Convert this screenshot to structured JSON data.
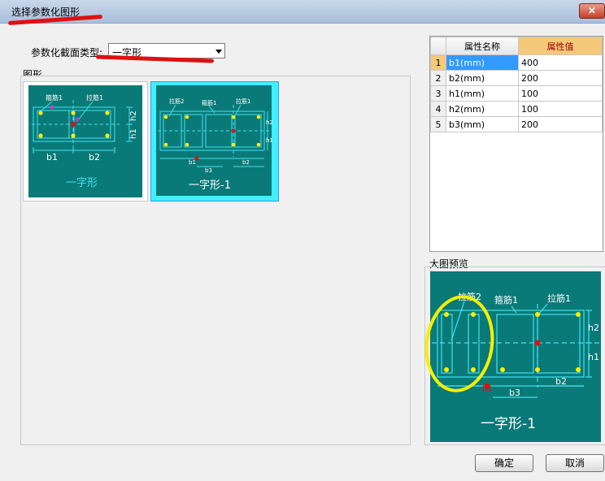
{
  "window": {
    "title": "选择参数化图形",
    "close_label": "×"
  },
  "section_type": {
    "label": "参数化截面类型:",
    "selected": "一字形"
  },
  "shapes_group": {
    "label": "图形",
    "items": [
      {
        "caption": "一字形",
        "dim_b1": "b1",
        "dim_b2": "b2",
        "dim_h1": "h1",
        "dim_h2": "h2",
        "lbl_gujin": "箍筋1",
        "lbl_lajin": "拉筋1"
      },
      {
        "caption": "一字形-1",
        "lbl_lajin2": "拉筋2",
        "lbl_gujin": "箍筋1",
        "lbl_lajin1": "拉筋1",
        "dim_h1": "h1",
        "dim_h2": "h2",
        "dim_b1": "b1",
        "dim_b2": "b2",
        "dim_b3": "b3"
      }
    ]
  },
  "property_table": {
    "headers": [
      "属性名称",
      "属性值"
    ],
    "rows": [
      {
        "index": "1",
        "name": "b1(mm)",
        "value": "400"
      },
      {
        "index": "2",
        "name": "b2(mm)",
        "value": "200"
      },
      {
        "index": "3",
        "name": "h1(mm)",
        "value": "100"
      },
      {
        "index": "4",
        "name": "h2(mm)",
        "value": "100"
      },
      {
        "index": "5",
        "name": "b3(mm)",
        "value": "200"
      }
    ]
  },
  "preview": {
    "label": "大图预览",
    "caption": "一字形-1",
    "lbl_lajin2": "拉筋2",
    "lbl_gujin": "箍筋1",
    "lbl_lajin1": "拉筋1",
    "dim_h2": "h2",
    "dim_h1": "h1",
    "dim_b1": "b1",
    "dim_b2": "b2",
    "dim_b3": "b3"
  },
  "buttons": {
    "ok": "确定",
    "cancel": "取消"
  },
  "colors": {
    "drawing_bg": "#0a7a78",
    "rebar_line": "#40e0f0",
    "rebar_dot": "#ffee00",
    "annotation_red": "#e01010",
    "annotation_yellow": "#f5f000"
  }
}
